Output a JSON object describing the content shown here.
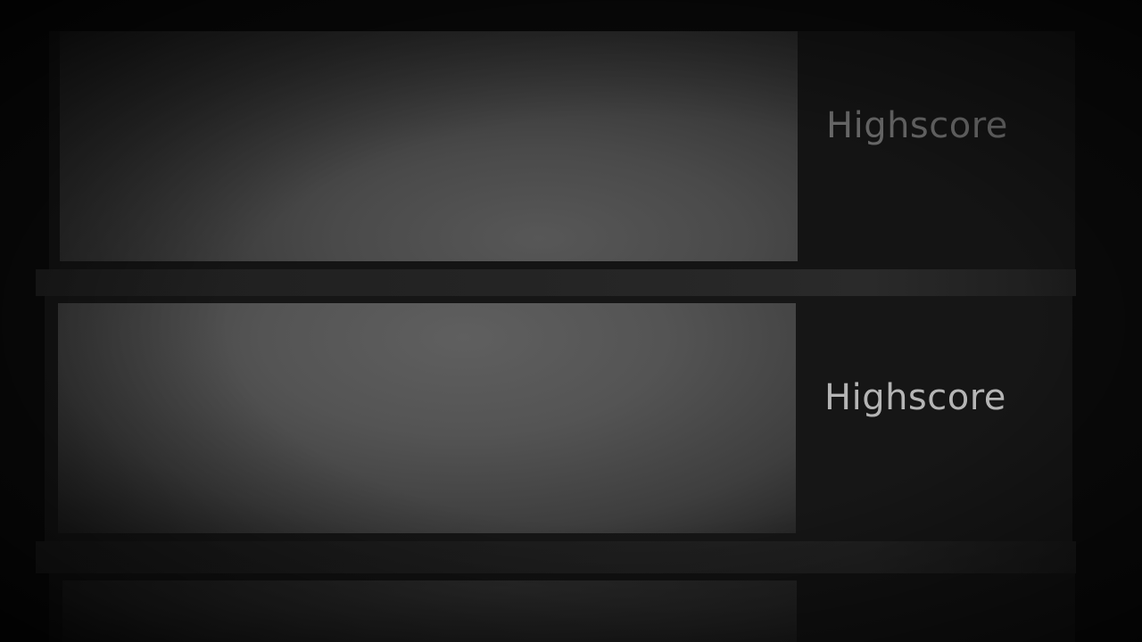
{
  "highscore_list": {
    "entries": [
      {
        "label": "Highscore"
      },
      {
        "label": "Highscore"
      },
      {
        "label": ""
      }
    ]
  }
}
